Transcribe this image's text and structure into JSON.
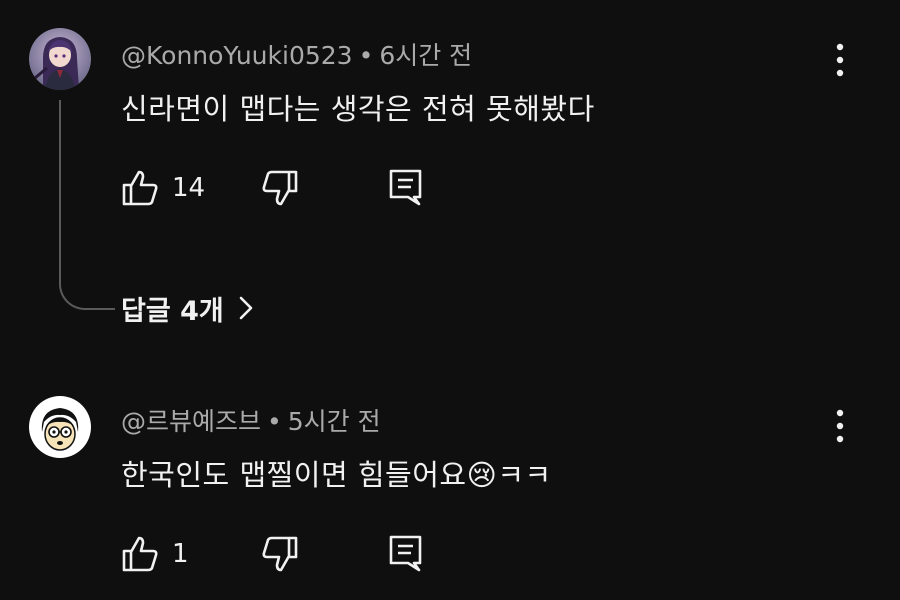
{
  "comments": [
    {
      "author": "@KonnoYuuki0523",
      "separator": "•",
      "time": "6시간 전",
      "text": "신라면이  맵다는  생각은  전혀  못해봤다",
      "likes": "14",
      "avatar_icon": "anime-character-avatar",
      "replies_label": "답글 4개"
    },
    {
      "author": "@르뷰예즈브",
      "separator": "•",
      "time": "5시간 전",
      "text": "한국인도 맵찔이면 힘들어요😢ㅋㅋ",
      "likes": "1",
      "avatar_icon": "cartoon-face-avatar"
    }
  ],
  "colors": {
    "background": "#0f0f0f",
    "primary_text": "#f1f1f1",
    "secondary_text": "#aaaaaa",
    "thread_line": "#5a5a5a"
  }
}
